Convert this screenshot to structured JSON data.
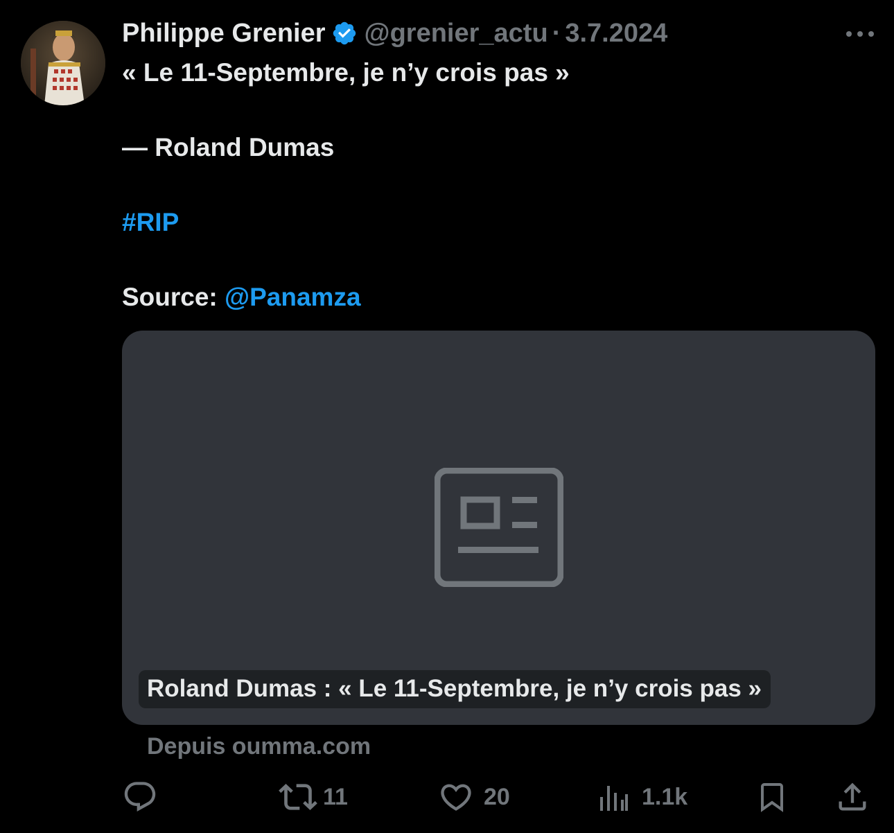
{
  "author": {
    "name": "Philippe Grenier",
    "handle": "@grenier_actu",
    "separator": "·",
    "date": "3.7.2024"
  },
  "tweet": {
    "line1": "« Le 11-Septembre, je n’y crois pas »",
    "line2": "— Roland Dumas",
    "hashtag": "#RIP",
    "source_label": "Source: ",
    "source_mention": "@Panamza"
  },
  "card": {
    "title": "Roland Dumas : « Le 11-Septembre, je n’y crois pas »",
    "source": "Depuis oumma.com"
  },
  "actions": {
    "reply_count": "",
    "retweet_count": "11",
    "like_count": "20",
    "views_count": "1.1k"
  },
  "colors": {
    "background": "#000000",
    "text": "#e7e9ea",
    "muted": "#71767b",
    "accent": "#1d9bf0",
    "card_bg": "#31343a"
  },
  "icons": [
    "verified-badge-icon",
    "more-icon",
    "article-placeholder-icon",
    "reply-icon",
    "retweet-icon",
    "like-icon",
    "views-icon",
    "bookmark-icon",
    "share-icon"
  ]
}
